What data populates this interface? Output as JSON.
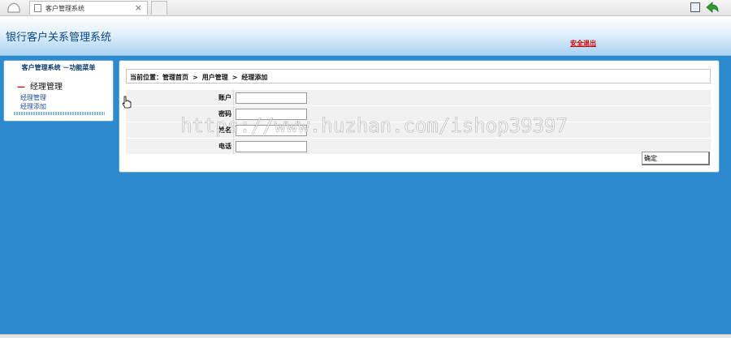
{
  "browser": {
    "tab_title": "客户管理系统",
    "tab_close": "×"
  },
  "header": {
    "title": "银行客户关系管理系统",
    "logout": "安全退出"
  },
  "sidebar": {
    "title": "客户管理系统 －功能菜单",
    "section": "经理管理",
    "section_marker": "—",
    "items": [
      {
        "label": "经理管理"
      },
      {
        "label": "经理添加"
      }
    ]
  },
  "breadcrumb": {
    "prefix": "当前位置：",
    "items": [
      "管理首页",
      "用户管理",
      "经理添加"
    ],
    "separator": ">"
  },
  "form": {
    "fields": [
      {
        "label": "账户",
        "value": ""
      },
      {
        "label": "密码",
        "value": ""
      },
      {
        "label": "姓名",
        "value": ""
      },
      {
        "label": "电话",
        "value": ""
      }
    ],
    "submit": "确定"
  },
  "watermark": "https://www.huzhan.com/ishop39397"
}
